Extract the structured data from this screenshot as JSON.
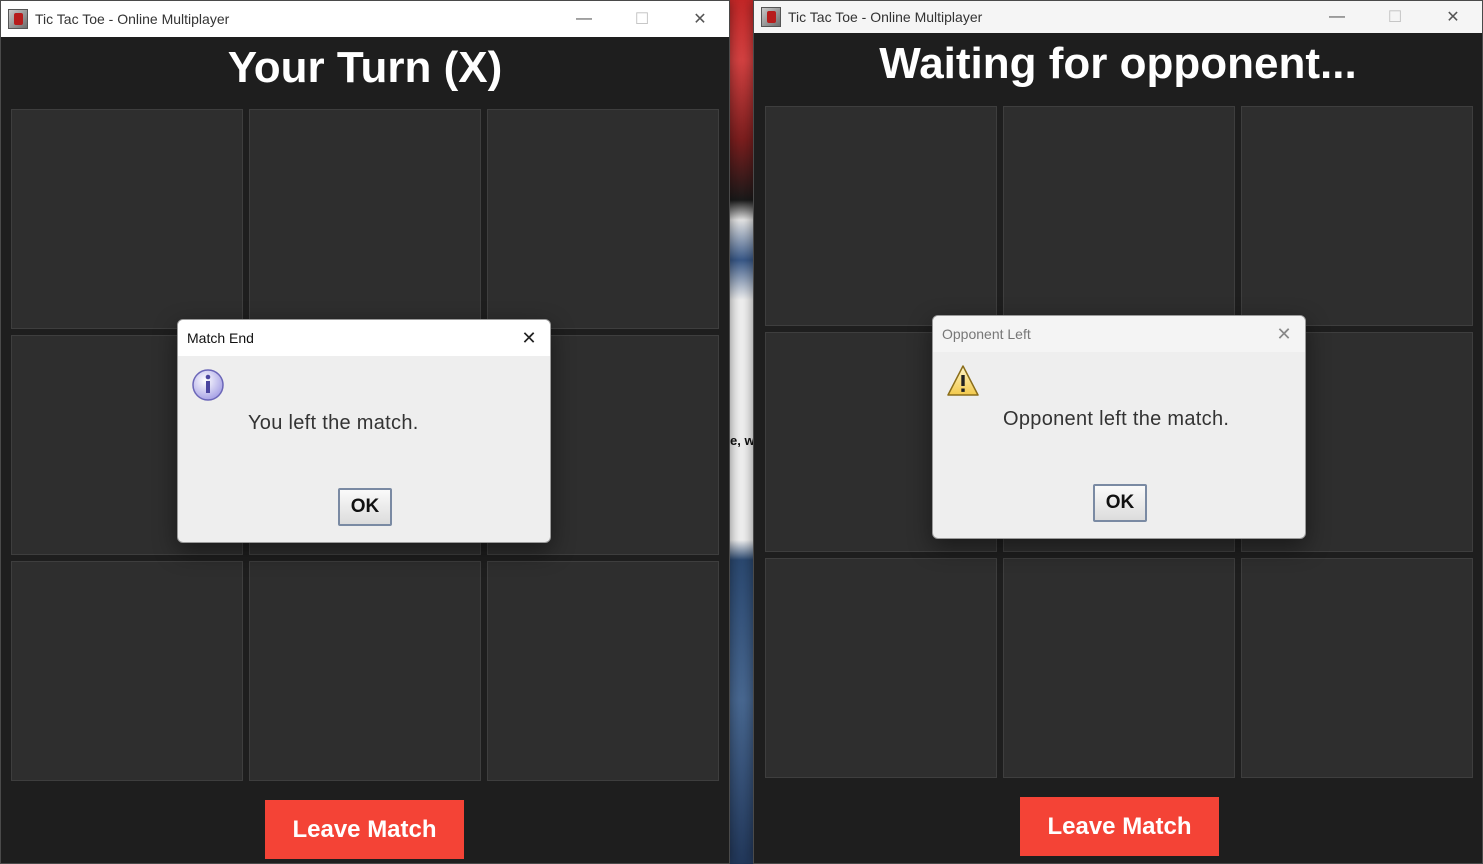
{
  "left_window": {
    "title": "Tic Tac Toe - Online Multiplayer",
    "heading": "Your Turn (X)",
    "board": [
      "",
      "",
      "",
      "",
      "",
      "",
      "",
      "",
      ""
    ],
    "leave_button": "Leave Match",
    "dialog": {
      "title": "Match End",
      "message": "You left the match.",
      "ok_label": "OK",
      "icon": "info-icon"
    }
  },
  "right_window": {
    "title": "Tic Tac Toe - Online Multiplayer",
    "heading": "Waiting for opponent...",
    "board": [
      "",
      "",
      "",
      "",
      "",
      "",
      "",
      "",
      ""
    ],
    "leave_button": "Leave Match",
    "dialog": {
      "title": "Opponent Left",
      "message": "Opponent left the match.",
      "ok_label": "OK",
      "icon": "warning-icon"
    }
  },
  "window_controls": {
    "minimize": "—",
    "maximize": "☐",
    "close": "✕"
  },
  "background_fragment": "e, w",
  "colors": {
    "window_bg": "#1e1e1e",
    "cell_bg": "#2e2e2e",
    "leave_button": "#f44336"
  }
}
